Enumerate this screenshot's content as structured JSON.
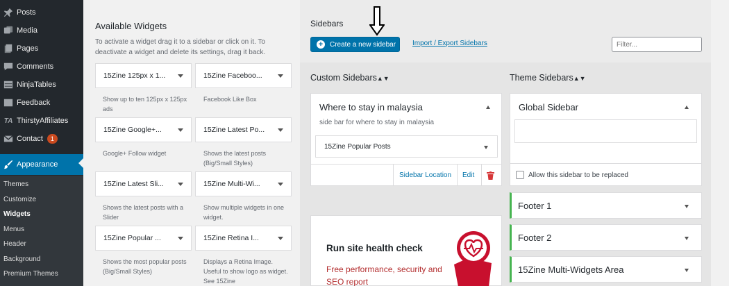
{
  "admin_menu": {
    "items": [
      {
        "label": "Posts",
        "icon": "pin-icon"
      },
      {
        "label": "Media",
        "icon": "media-icon"
      },
      {
        "label": "Pages",
        "icon": "pages-icon"
      },
      {
        "label": "Comments",
        "icon": "comments-icon"
      },
      {
        "label": "NinjaTables",
        "icon": "table-icon"
      },
      {
        "label": "Feedback",
        "icon": "feedback-icon"
      },
      {
        "label": "ThirstyAffiliates",
        "icon": "ta-icon"
      },
      {
        "label": "Contact",
        "icon": "mail-icon",
        "badge": "1"
      },
      {
        "label": "Appearance",
        "icon": "brush-icon"
      }
    ],
    "submenu": [
      "Themes",
      "Customize",
      "Widgets",
      "Menus",
      "Header",
      "Background",
      "Premium Themes"
    ],
    "active_sub": "Widgets"
  },
  "available": {
    "title": "Available Widgets",
    "description": "To activate a widget drag it to a sidebar or click on it. To deactivate a widget and delete its settings, drag it back.",
    "widgets": [
      {
        "name": "15Zine 125px x 1...",
        "desc": "Show up to ten 125px x 125px ads"
      },
      {
        "name": "15Zine Faceboo...",
        "desc": "Facebook Like Box"
      },
      {
        "name": "15Zine Google+...",
        "desc": "Google+ Follow widget"
      },
      {
        "name": "15Zine Latest Po...",
        "desc": "Shows the latest posts (Big/Small Styles)"
      },
      {
        "name": "15Zine Latest Sli...",
        "desc": "Shows the latest posts with a Slider"
      },
      {
        "name": "15Zine Multi-Wi...",
        "desc": "Show multiple widgets in one widget."
      },
      {
        "name": "15Zine Popular ...",
        "desc": "Shows the most popular posts (Big/Small Styles)"
      },
      {
        "name": "15Zine Retina I...",
        "desc": "Displays a Retina Image. Useful to show logo as widget. See 15Zine"
      }
    ]
  },
  "sidebars": {
    "title": "Sidebars",
    "create_button": "Create a new sidebar",
    "import_export": "Import / Export Sidebars",
    "filter_placeholder": "Filter...",
    "custom_title": "Custom Sidebars",
    "theme_title": "Theme Sidebars",
    "sort_glyph": "▲▼",
    "custom_box": {
      "name": "Where to stay in malaysia",
      "desc": "side bar for where to stay in malaysia",
      "widget": "15Zine Popular Posts",
      "location_link": "Sidebar Location",
      "edit_link": "Edit"
    },
    "global_box": {
      "name": "Global Sidebar",
      "replace_label": "Allow this sidebar to be replaced",
      "replace_checked": false
    },
    "footers": [
      "Footer 1",
      "Footer 2",
      "15Zine Multi-Widgets Area"
    ]
  },
  "health_card": {
    "title": "Run site health check",
    "subtitle": "Free performance, security and SEO report"
  },
  "colors": {
    "accent": "#0073aa",
    "admin_bg": "#23282d",
    "badge": "#ca4a1f",
    "health_red": "#b32d2e",
    "footer_border": "#46b450"
  }
}
